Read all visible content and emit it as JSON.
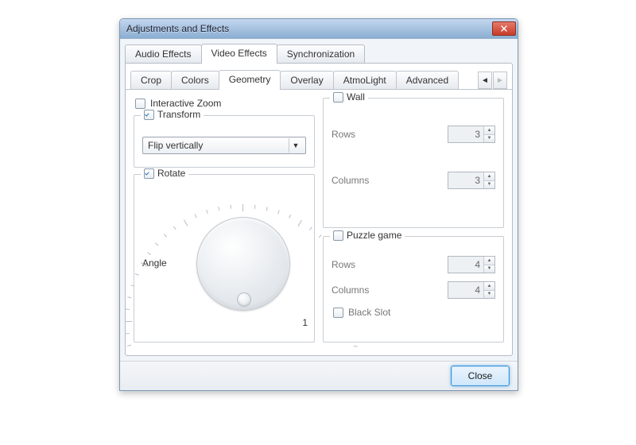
{
  "window": {
    "title": "Adjustments and Effects"
  },
  "tabs": {
    "items": [
      {
        "label": "Audio Effects"
      },
      {
        "label": "Video Effects"
      },
      {
        "label": "Synchronization"
      }
    ],
    "active_index": 1
  },
  "subtabs": {
    "items": [
      {
        "label": "Crop"
      },
      {
        "label": "Colors"
      },
      {
        "label": "Geometry"
      },
      {
        "label": "Overlay"
      },
      {
        "label": "AtmoLight"
      },
      {
        "label": "Advanced"
      }
    ],
    "active_index": 2
  },
  "geometry": {
    "interactive_zoom": {
      "label": "Interactive Zoom",
      "checked": false
    },
    "transform": {
      "label": "Transform",
      "checked": true,
      "selected": "Flip vertically"
    },
    "rotate": {
      "label": "Rotate",
      "checked": true,
      "angle_label": "Angle",
      "value_display": "1"
    },
    "wall": {
      "label": "Wall",
      "checked": false,
      "rows_label": "Rows",
      "rows_value": "3",
      "columns_label": "Columns",
      "columns_value": "3"
    },
    "puzzle": {
      "label": "Puzzle game",
      "checked": false,
      "rows_label": "Rows",
      "rows_value": "4",
      "columns_label": "Columns",
      "columns_value": "4",
      "black_slot_label": "Black Slot",
      "black_slot_checked": false
    }
  },
  "footer": {
    "close_label": "Close"
  }
}
